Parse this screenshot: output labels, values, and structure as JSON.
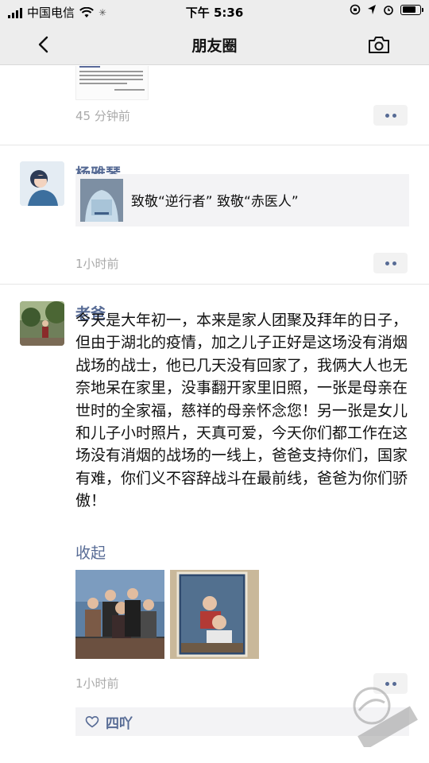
{
  "status_bar": {
    "carrier": "中国电信",
    "time": "下午 5:36"
  },
  "nav": {
    "title": "朋友圈"
  },
  "posts": [
    {
      "timestamp": "45 分钟前"
    },
    {
      "author": "杨雅琴",
      "share_title": "致敬“逆行者” 致敬“赤医人”",
      "timestamp": "1小时前"
    },
    {
      "author": "老爸",
      "text": "今天是大年初一，本来是家人团聚及拜年的日子，但由于湖北的疫情，加之儿子正好是这场没有消烟战场的战士，他已几天没有回家了，我俩大人也无奈地呆在家里，没事翻开家里旧照，一张是母亲在世时的全家福，慈祥的母亲怀念您！另一张是女儿和儿子小时照片，天真可爱，今天你们都工作在这场没有消烟的战场的一线上，爸爸支持你们，国家有难，你们义不容辞战斗在最前线，爸爸为你们骄傲！",
      "collapse_label": "收起",
      "timestamp": "1小时前",
      "likes": [
        "四吖"
      ]
    }
  ],
  "colors": {
    "link_blue": "#576b95",
    "bar_bg": "#ededed",
    "muted": "#aaaaaa"
  }
}
